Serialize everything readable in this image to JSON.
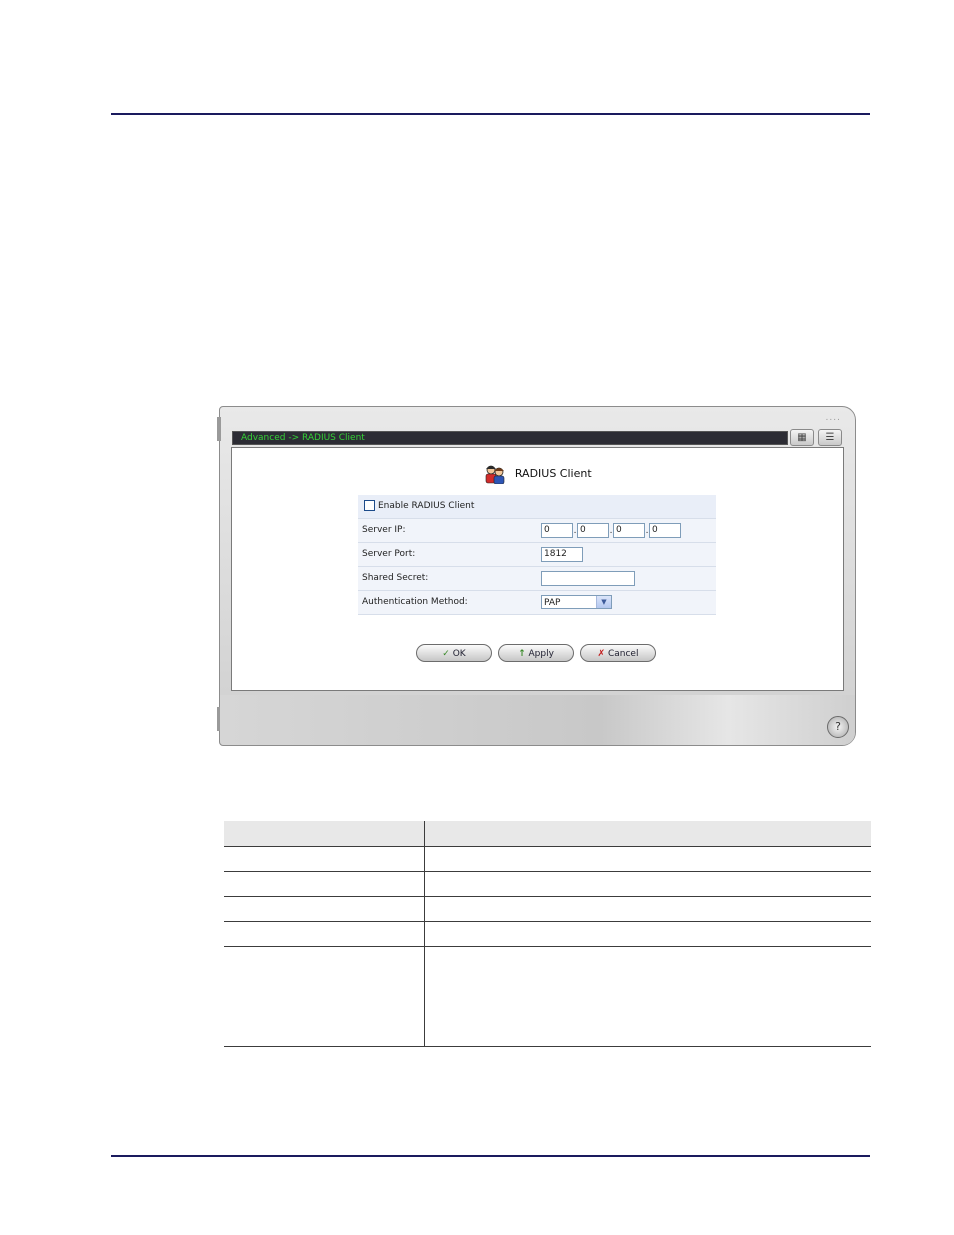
{
  "window": {
    "breadcrumb": "Advanced -> RADIUS Client",
    "page_title": "RADIUS Client",
    "grip": "....",
    "toolbar_icons": [
      "network-map-icon",
      "menu-list-icon"
    ],
    "help_glyph": "?"
  },
  "form": {
    "enable_label": "Enable RADIUS Client",
    "enable_checked": false,
    "server_ip_label": "Server IP:",
    "server_ip": [
      "0",
      "0",
      "0",
      "0"
    ],
    "server_port_label": "Server Port:",
    "server_port": "1812",
    "shared_secret_label": "Shared Secret:",
    "shared_secret": "",
    "auth_method_label": "Authentication Method:",
    "auth_method": "PAP"
  },
  "buttons": {
    "ok": "OK",
    "apply": "Apply",
    "cancel": "Cancel"
  },
  "colors": {
    "rule": "#1a1a5e",
    "breadcrumb_text": "#35d135",
    "titlebar_bg": "#2c2c34"
  }
}
